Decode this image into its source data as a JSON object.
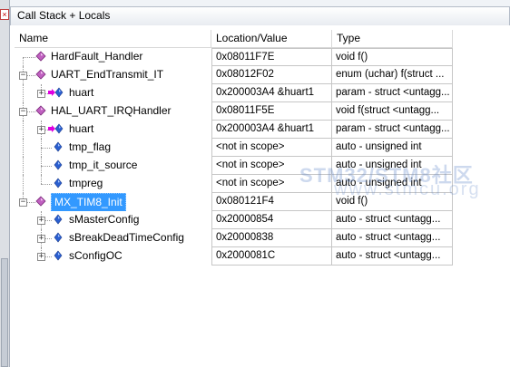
{
  "window": {
    "title": "Call Stack + Locals",
    "close_glyph": "×"
  },
  "columns": {
    "name": "Name",
    "location": "Location/Value",
    "type": "Type"
  },
  "rows": [
    {
      "name": "HardFault_Handler",
      "location": "0x08011F7E",
      "type": "void f()",
      "icon": "function-icon",
      "depth": 0,
      "expander": ""
    },
    {
      "name": "UART_EndTransmit_IT",
      "location": "0x08012F02",
      "type": "enum (uchar) f(struct ...",
      "icon": "function-icon",
      "depth": 0,
      "expander": "−"
    },
    {
      "name": "huart",
      "location": "0x200003A4 &huart1",
      "type": "param - struct <untagg...",
      "icon": "parameter-icon",
      "depth": 1,
      "expander": "+"
    },
    {
      "name": "HAL_UART_IRQHandler",
      "location": "0x08011F5E",
      "type": "void f(struct <untagg...",
      "icon": "function-icon",
      "depth": 0,
      "expander": "−"
    },
    {
      "name": "huart",
      "location": "0x200003A4 &huart1",
      "type": "param - struct <untagg...",
      "icon": "parameter-icon",
      "depth": 1,
      "expander": "+"
    },
    {
      "name": "tmp_flag",
      "location": "<not in scope>",
      "type": "auto - unsigned int",
      "icon": "variable-icon",
      "depth": 1,
      "expander": ""
    },
    {
      "name": "tmp_it_source",
      "location": "<not in scope>",
      "type": "auto - unsigned int",
      "icon": "variable-icon",
      "depth": 1,
      "expander": ""
    },
    {
      "name": "tmpreg",
      "location": "<not in scope>",
      "type": "auto - unsigned int",
      "icon": "variable-icon",
      "depth": 1,
      "expander": ""
    },
    {
      "name": "MX_TIM8_Init",
      "location": "0x080121F4",
      "type": "void f()",
      "icon": "function-icon",
      "depth": 0,
      "expander": "−",
      "selected": true
    },
    {
      "name": "sMasterConfig",
      "location": "0x20000854",
      "type": "auto - struct <untagg...",
      "icon": "variable-icon",
      "depth": 1,
      "expander": "+"
    },
    {
      "name": "sBreakDeadTimeConfig",
      "location": "0x20000838",
      "type": "auto - struct <untagg...",
      "icon": "variable-icon",
      "depth": 1,
      "expander": "+"
    },
    {
      "name": "sConfigOC",
      "location": "0x2000081C",
      "type": "auto - struct <untagg...",
      "icon": "variable-icon",
      "depth": 1,
      "expander": "+"
    }
  ],
  "watermark": {
    "line1": "STM32/STM8社区",
    "line2": "www.stmcu.org"
  },
  "colors": {
    "selection": "#3399ff",
    "function_icon": "#c060c0",
    "variable_icon": "#2a5fd0",
    "param_arrow": "#e000e0"
  }
}
